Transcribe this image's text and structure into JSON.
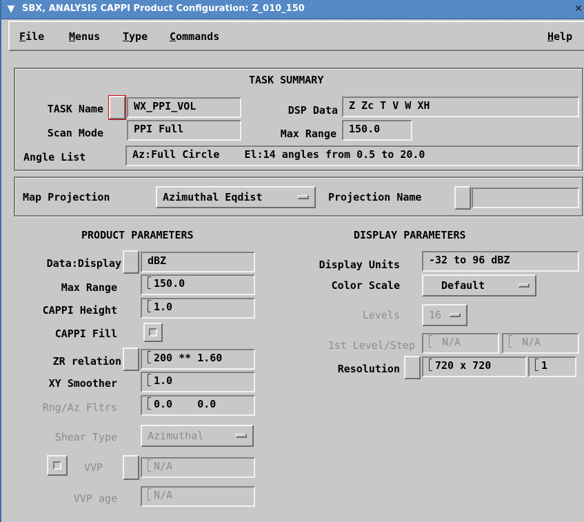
{
  "window": {
    "title": "SBX, ANALYSIS  CAPPI Product Configuration: Z_010_150",
    "menu_icon": "chevron-down-icon",
    "close_icon": "close-icon"
  },
  "menubar": {
    "file": {
      "u": "F",
      "rest": "ile"
    },
    "menus": {
      "u": "M",
      "rest": "enus"
    },
    "type": {
      "u": "T",
      "rest": "ype"
    },
    "commands": {
      "u": "C",
      "rest": "ommands"
    },
    "help": {
      "u": "H",
      "rest": "elp"
    }
  },
  "task_summary": {
    "heading": "TASK SUMMARY",
    "task_name_label": "TASK Name",
    "task_name_value": "WX_PPI_VOL",
    "dsp_data_label": "DSP Data",
    "dsp_data_value": "Z Zc T V W XH",
    "scan_mode_label": "Scan Mode",
    "scan_mode_value": "PPI Full",
    "max_range_label": "Max Range",
    "max_range_value": "150.0",
    "angle_list_label": "Angle List",
    "angle_list_value": "Az:Full Circle    El:14 angles from 0.5 to 20.0"
  },
  "map": {
    "projection_label": "Map Projection",
    "projection_value": "Azimuthal Eqdist",
    "projection_name_label": "Projection Name",
    "projection_name_value": ""
  },
  "product_parameters": {
    "heading": "PRODUCT PARAMETERS",
    "data_display_label": "Data:Display",
    "data_display_value": "dBZ",
    "max_range_label": "Max Range",
    "max_range_value": "150.0",
    "cappi_height_label": "CAPPI Height",
    "cappi_height_value": "1.0",
    "cappi_fill_label": "CAPPI Fill",
    "zr_relation_label": "ZR relation",
    "zr_relation_value": "200 ** 1.60",
    "xy_smoother_label": "XY Smoother",
    "xy_smoother_value": "1.0",
    "rng_az_label": "Rng/Az Fltrs",
    "rng_az_value": "0.0    0.0",
    "shear_type_label": "Shear Type",
    "shear_type_value": "Azimuthal",
    "vvp_label": "VVP",
    "vvp_value": "N/A",
    "vvp_age_label": "VVP age",
    "vvp_age_value": "N/A"
  },
  "display_parameters": {
    "heading": "DISPLAY PARAMETERS",
    "display_units_label": "Display Units",
    "display_units_value": "-32 to 96 dBZ",
    "color_scale_label": "Color Scale",
    "color_scale_value": "Default",
    "levels_label": "Levels",
    "levels_value": "16",
    "first_level_label": "1st Level/Step",
    "first_level_value": "N/A",
    "step_value": "N/A",
    "resolution_label": "Resolution",
    "resolution_value": "720 x 720",
    "resolution_factor": "1"
  },
  "colors": {
    "background": "#c8c8c8",
    "titlebar": "#4f84c0",
    "disabled_text": "#8c8c8c",
    "focus_outline": "#d00000"
  }
}
